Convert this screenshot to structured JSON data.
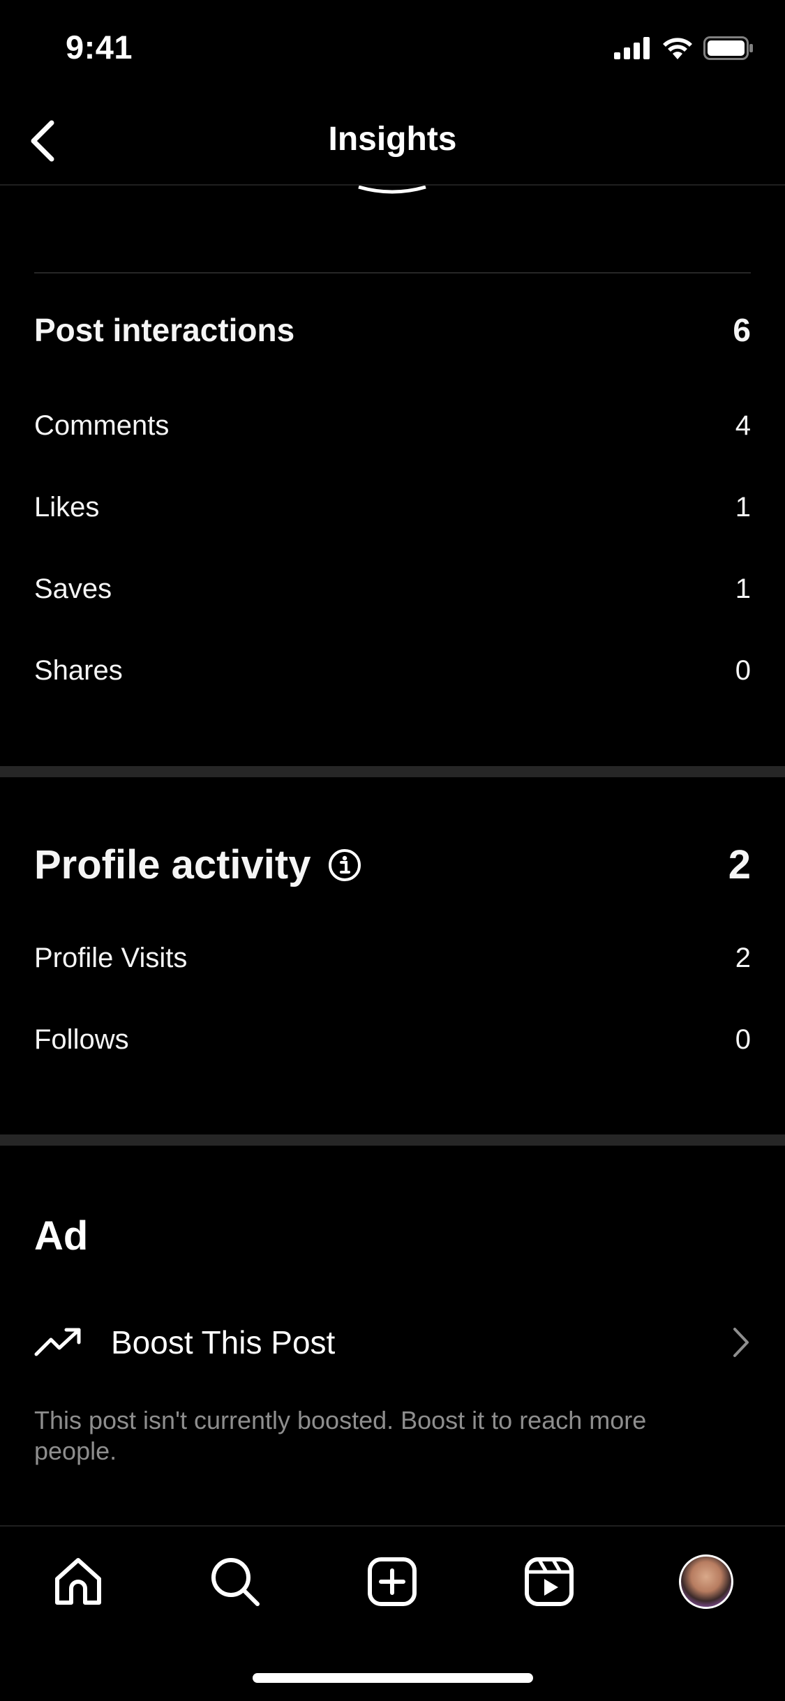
{
  "status_bar": {
    "time": "9:41"
  },
  "header": {
    "title": "Insights"
  },
  "post_interactions": {
    "title": "Post interactions",
    "total": "6",
    "rows": [
      {
        "label": "Comments",
        "value": "4"
      },
      {
        "label": "Likes",
        "value": "1"
      },
      {
        "label": "Saves",
        "value": "1"
      },
      {
        "label": "Shares",
        "value": "0"
      }
    ]
  },
  "profile_activity": {
    "title": "Profile activity",
    "total": "2",
    "rows": [
      {
        "label": "Profile Visits",
        "value": "2"
      },
      {
        "label": "Follows",
        "value": "0"
      }
    ]
  },
  "ad": {
    "title": "Ad",
    "boost_label": "Boost This Post",
    "description": "This post isn't currently boosted. Boost it to reach more people."
  },
  "tab_bar": {
    "tabs": [
      {
        "icon": "home-icon"
      },
      {
        "icon": "search-icon"
      },
      {
        "icon": "create-icon"
      },
      {
        "icon": "reels-icon"
      },
      {
        "icon": "profile-avatar"
      }
    ]
  },
  "colors": {
    "background": "#000000",
    "text": "#ffffff",
    "secondary_text": "#8e8e8e",
    "divider": "#262626"
  }
}
